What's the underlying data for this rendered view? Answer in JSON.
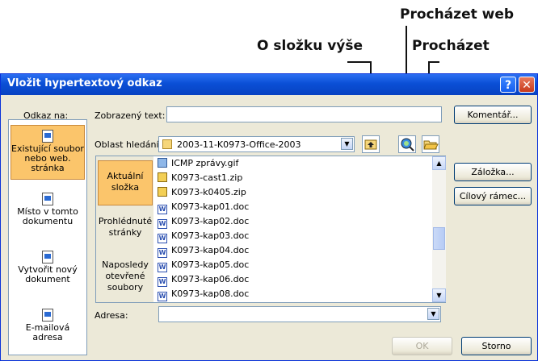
{
  "callouts": {
    "browse_web": "Procházet web",
    "up_folder": "O složku výše",
    "browse": "Procházet"
  },
  "dialog": {
    "title": "Vložit hypertextový odkaz",
    "help": "?",
    "close": "✕",
    "link_to_label": "Odkaz na:",
    "sidebar": [
      {
        "name": "existing-file",
        "label": "Existující soubor nebo web. stránka",
        "selected": true
      },
      {
        "name": "place-in-document",
        "label": "Místo v tomto dokumentu",
        "selected": false
      },
      {
        "name": "new-document",
        "label": "Vytvořit nový dokument",
        "selected": false
      },
      {
        "name": "email-address",
        "label": "E-mailová adresa",
        "selected": false
      }
    ],
    "display_text_label": "Zobrazený text:",
    "display_text_value": "",
    "comment_button": "Komentář...",
    "look_in_label": "Oblast hledání:",
    "look_in_value": "2003-11-K0973-Office-2003",
    "nav": [
      {
        "name": "current-folder",
        "label": "Aktuální složka",
        "selected": true
      },
      {
        "name": "browsed-pages",
        "label": "Prohlédnuté stránky",
        "selected": false
      },
      {
        "name": "recent-files",
        "label": "Naposledy otevřené soubory",
        "selected": false
      }
    ],
    "files": [
      {
        "name": "ICMP zprávy.gif",
        "type": "gif"
      },
      {
        "name": "K0973-cast1.zip",
        "type": "zip"
      },
      {
        "name": "K0973-k0405.zip",
        "type": "zip"
      },
      {
        "name": "K0973-kap01.doc",
        "type": "word"
      },
      {
        "name": "K0973-kap02.doc",
        "type": "word"
      },
      {
        "name": "K0973-kap03.doc",
        "type": "word"
      },
      {
        "name": "K0973-kap04.doc",
        "type": "word"
      },
      {
        "name": "K0973-kap05.doc",
        "type": "word"
      },
      {
        "name": "K0973-kap06.doc",
        "type": "word"
      },
      {
        "name": "K0973-kap08.doc",
        "type": "word"
      }
    ],
    "bookmark_button": "Záložka...",
    "target_frame_button": "Cílový rámec...",
    "address_label": "Adresa:",
    "address_value": "",
    "ok_button": "OK",
    "cancel_button": "Storno"
  },
  "colors": {
    "title_bar": "#0a4fd6",
    "selection": "#fbc56b",
    "dialog_bg": "#ece9d8"
  }
}
